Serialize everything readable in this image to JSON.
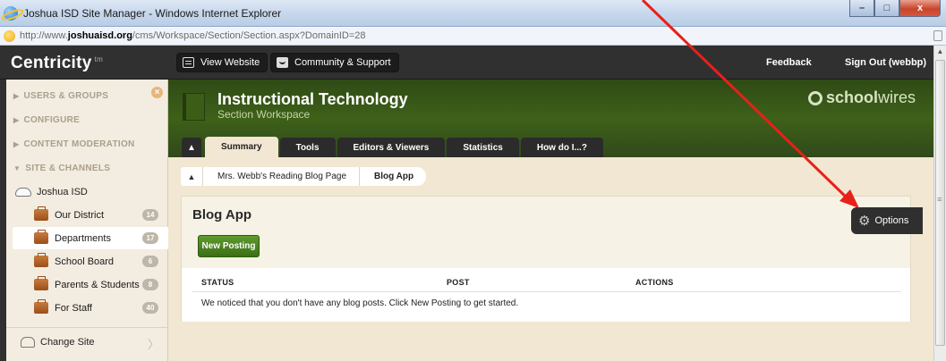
{
  "window": {
    "title": "Joshua ISD Site Manager - Windows Internet Explorer",
    "url_prefix": "http://www.",
    "url_domain": "joshuaisd.org",
    "url_path": "/cms/Workspace/Section/Section.aspx?DomainID=28",
    "btn_minimize": "–",
    "btn_maximize": "□",
    "btn_close": "x"
  },
  "app": {
    "brand": "Centricity",
    "brand_tm": "tm",
    "view_website": "View Website",
    "community": "Community & Support",
    "feedback": "Feedback",
    "sign_out": "Sign Out (webbp)"
  },
  "sidebar": {
    "users_groups": "USERS & GROUPS",
    "configure": "CONFIGURE",
    "content_moderation": "CONTENT MODERATION",
    "site_channels": "SITE & CHANNELS",
    "site_name": "Joshua ISD",
    "close_symbol": "×",
    "channels": [
      {
        "label": "Our District",
        "count": "14"
      },
      {
        "label": "Departments",
        "count": "17"
      },
      {
        "label": "School Board",
        "count": "6"
      },
      {
        "label": "Parents & Students",
        "count": "8"
      },
      {
        "label": "For Staff",
        "count": "40"
      }
    ],
    "change_site": "Change Site"
  },
  "header": {
    "title": "Instructional Technology",
    "subtitle": "Section Workspace",
    "logo_bold": "school",
    "logo_light": "wires"
  },
  "tabs": [
    "Summary",
    "Tools",
    "Editors & Viewers",
    "Statistics",
    "How do I...?"
  ],
  "breadcrumb": {
    "page": "Mrs. Webb's Reading Blog Page",
    "current": "Blog App"
  },
  "panel": {
    "title": "Blog App",
    "new_posting": "New Posting",
    "columns": [
      "STATUS",
      "POST",
      "ACTIONS"
    ],
    "empty_message": "We noticed that you don't have any blog posts. Click New Posting to get started."
  },
  "options": {
    "label": "Options"
  },
  "colors": {
    "annotation_arrow": "#e8201a",
    "header_green": "#3e6119",
    "button_green": "#4d8522"
  }
}
